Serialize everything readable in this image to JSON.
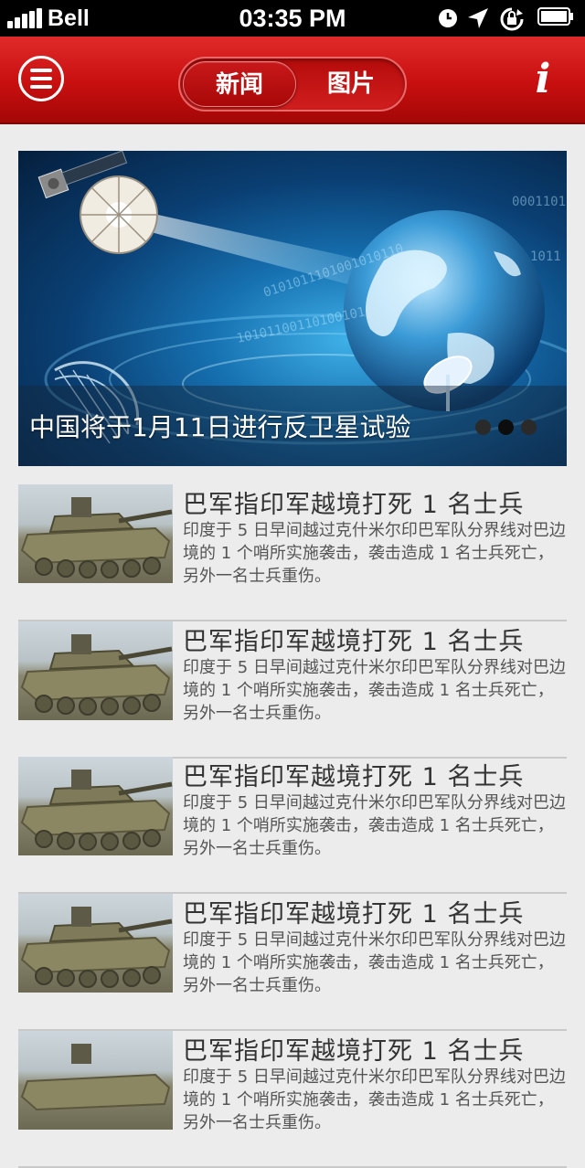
{
  "status_bar": {
    "carrier": "Bell",
    "time": "03:35 PM"
  },
  "nav": {
    "tabs": [
      {
        "label": "新闻",
        "active": true
      },
      {
        "label": "图片",
        "active": false
      }
    ],
    "info_label": "i"
  },
  "hero": {
    "caption": "中国将于1月11日进行反卫星试验",
    "page_count": 3,
    "active_page": 2
  },
  "news": [
    {
      "title": "巴军指印军越境打死 1 名士兵",
      "summary": "印度于 5 日早间越过克什米尔印巴军队分界线对巴边境的 1 个哨所实施袭击，袭击造成 1 名士兵死亡，另外一名士兵重伤。"
    },
    {
      "title": "巴军指印军越境打死 1 名士兵",
      "summary": "印度于 5 日早间越过克什米尔印巴军队分界线对巴边境的 1 个哨所实施袭击，袭击造成 1 名士兵死亡，另外一名士兵重伤。"
    },
    {
      "title": "巴军指印军越境打死 1 名士兵",
      "summary": "印度于 5 日早间越过克什米尔印巴军队分界线对巴边境的 1 个哨所实施袭击，袭击造成 1 名士兵死亡，另外一名士兵重伤。"
    },
    {
      "title": "巴军指印军越境打死 1 名士兵",
      "summary": "印度于 5 日早间越过克什米尔印巴军队分界线对巴边境的 1 个哨所实施袭击，袭击造成 1 名士兵死亡，另外一名士兵重伤。"
    },
    {
      "title": "巴军指印军越境打死 1 名士兵",
      "summary": "印度于 5 日早间越过克什米尔印巴军队分界线对巴边境的 1 个哨所实施袭击，袭击造成 1 名士兵死亡，另外一名士兵重伤。"
    }
  ],
  "colors": {
    "nav_red": "#c80f0f",
    "background": "#ececec"
  }
}
